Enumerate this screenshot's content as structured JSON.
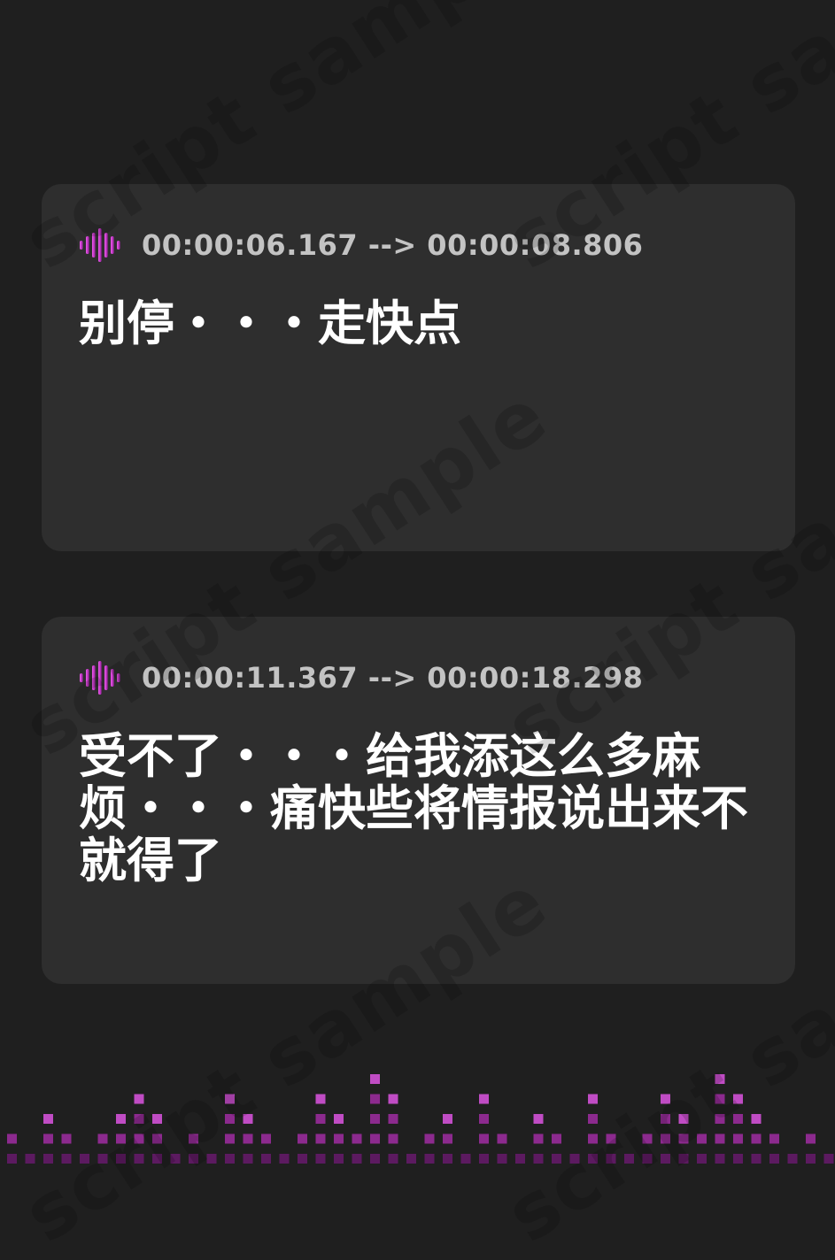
{
  "watermark": {
    "text": "script sample"
  },
  "entries": [
    {
      "timecode": "00:00:06.167 --> 00:00:08.806",
      "text": "别停・・・走快点"
    },
    {
      "timecode": "00:00:11.367 --> 00:00:18.298",
      "text": "受不了・・・给我添这么多麻烦・・・痛快些将情报说出来不就得了"
    }
  ],
  "icons": {
    "timestamp": "audio-waveform-icon"
  },
  "colors": {
    "background": "#1f1f1f",
    "card": "#2e2e2e",
    "timecode_text": "#c3c3c3",
    "subtitle_text": "#ffffff",
    "accent_light": "#e050e0",
    "accent_dark": "#8a1a8a",
    "equalizer_bright": "#c04cc4",
    "equalizer_mid": "#8c2a8e",
    "equalizer_dark": "#5c1a60"
  }
}
